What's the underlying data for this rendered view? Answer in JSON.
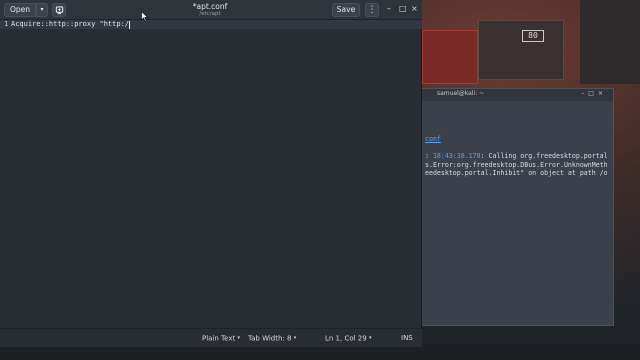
{
  "desktop": {
    "wall_screen_text": "80"
  },
  "terminal": {
    "title": "samuel@kali: ~",
    "controls": [
      "–",
      "□",
      "×"
    ],
    "lines": [
      {
        "parts": [
          {
            "text": "conf",
            "style": "file"
          }
        ]
      },
      {
        "parts": []
      },
      {
        "parts": [
          {
            "text": ": ",
            "style": "normal"
          },
          {
            "text": "18:43:38.178",
            "style": "blue"
          },
          {
            "text": ": Calling org.freedesktop.portal.",
            "style": "normal"
          }
        ]
      },
      {
        "parts": [
          {
            "text": "s.Error:org.freedesktop.DBus.Error.UnknownMetho",
            "style": "normal"
          }
        ]
      },
      {
        "parts": [
          {
            "text": "eedesktop.portal.Inhibit\" on object at path /or",
            "style": "normal"
          }
        ]
      }
    ]
  },
  "editor": {
    "title": "*apt.conf",
    "subtitle": "/etc/apt",
    "open_label": "Open",
    "open_arrow": "▾",
    "save_label": "Save",
    "menu_label": "⋮",
    "window_controls": {
      "minimize": "–",
      "maximize": "□",
      "close": "×"
    },
    "lines": [
      {
        "number": "1",
        "text": "Acquire::http::proxy \"http:/"
      }
    ],
    "status": {
      "language": "Plain Text",
      "tab_width": "Tab Width: 8",
      "position": "Ln 1, Col 29",
      "mode": "INS",
      "dropdown_arrow": "▾"
    }
  },
  "icons": {
    "new_document": "new-document-icon",
    "menu": "menu-icon",
    "cursor": "mouse-pointer-icon"
  },
  "colors": {
    "editor_bg": "#282c33",
    "header_bg": "#2f343b",
    "terminal_bg": "#3b414a",
    "accent_blue": "#5aa2e6"
  }
}
